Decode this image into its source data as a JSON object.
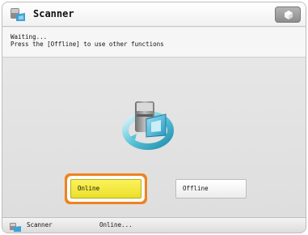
{
  "window": {
    "title": "Scanner"
  },
  "status": {
    "line1": "Waiting...",
    "line2": "Press the [Offline] to use other functions"
  },
  "buttons": {
    "online_label": "Online",
    "offline_label": "Offline"
  },
  "footer": {
    "app_label": "Scanner",
    "status_text": "Online..."
  },
  "colors": {
    "online_button": "#f5ea3f",
    "focus_ring": "#f0821e",
    "offline_button": "#f7f7f7"
  },
  "icons": {
    "title_icon": "scanner-icon",
    "corner_button_icon": "gem-icon",
    "center_graphic": "scanner-network-icon",
    "footer_icon": "scanner-icon"
  }
}
